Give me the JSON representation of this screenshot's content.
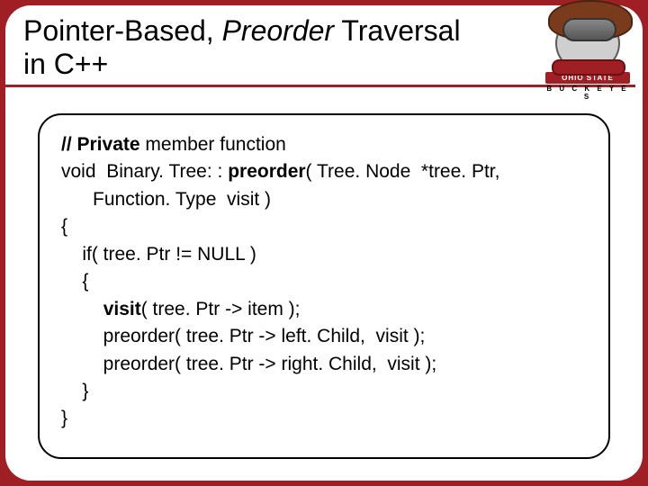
{
  "title": {
    "line1_a": "Pointer-Based, ",
    "line1_b": "Preorder",
    "line1_c": " Traversal",
    "line2": "in C++"
  },
  "logo": {
    "band_text": "OHIO STATE",
    "sub_text": "B U C K E Y E S"
  },
  "code": {
    "l1a": "// Private",
    "l1b": " member function",
    "l2a": "void  Binary. Tree: : ",
    "l2b": "preorder",
    "l2c": "( Tree. Node  *tree. Ptr,",
    "l3": "      Function. Type  visit )",
    "l4": "{",
    "l5": "    if( tree. Ptr != NULL )",
    "l6": "    {",
    "l7a": "        ",
    "l7b": "visit",
    "l7c": "( tree. Ptr -> item );",
    "l8": "        preorder( tree. Ptr -> left. Child,  visit );",
    "l9": "        preorder( tree. Ptr -> right. Child,  visit );",
    "l10": "    }",
    "l11": "}"
  }
}
